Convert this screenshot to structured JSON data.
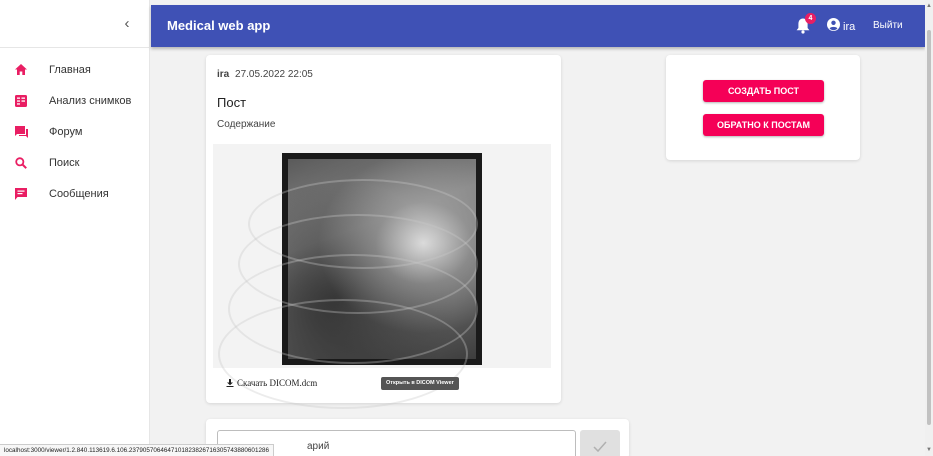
{
  "app": {
    "title": "Medical web app"
  },
  "header": {
    "notifications_count": "4",
    "user_name": "ira",
    "logout_label": "Выйти"
  },
  "sidebar": {
    "collapse_icon": "chevron-left-icon",
    "items": [
      {
        "label": "Главная",
        "icon": "home-icon"
      },
      {
        "label": "Анализ снимков",
        "icon": "grid-icon"
      },
      {
        "label": "Форум",
        "icon": "forum-icon"
      },
      {
        "label": "Поиск",
        "icon": "search-icon"
      },
      {
        "label": "Сообщения",
        "icon": "chat-icon"
      }
    ]
  },
  "post": {
    "author": "ira",
    "datetime": "27.05.2022 22:05",
    "title": "Пост",
    "content": "Содержание",
    "download_label": "Скачать DICOM.dcm",
    "open_viewer_label": "Открыть в DICOM Viewer"
  },
  "actions": {
    "create_label": "СОЗДАТЬ ПОСТ",
    "back_label": "ОБРАТНО К ПОСТАМ"
  },
  "comment": {
    "visible_text": "арий"
  },
  "statusbar": {
    "url": "localhost:3000/viewer/1.2.840.113619.6.106.2379057064647101823826716305743880601286"
  },
  "colors": {
    "appbar": "#3f51b5",
    "accent": "#f50057",
    "sidebar_icon": "#e91e63"
  }
}
